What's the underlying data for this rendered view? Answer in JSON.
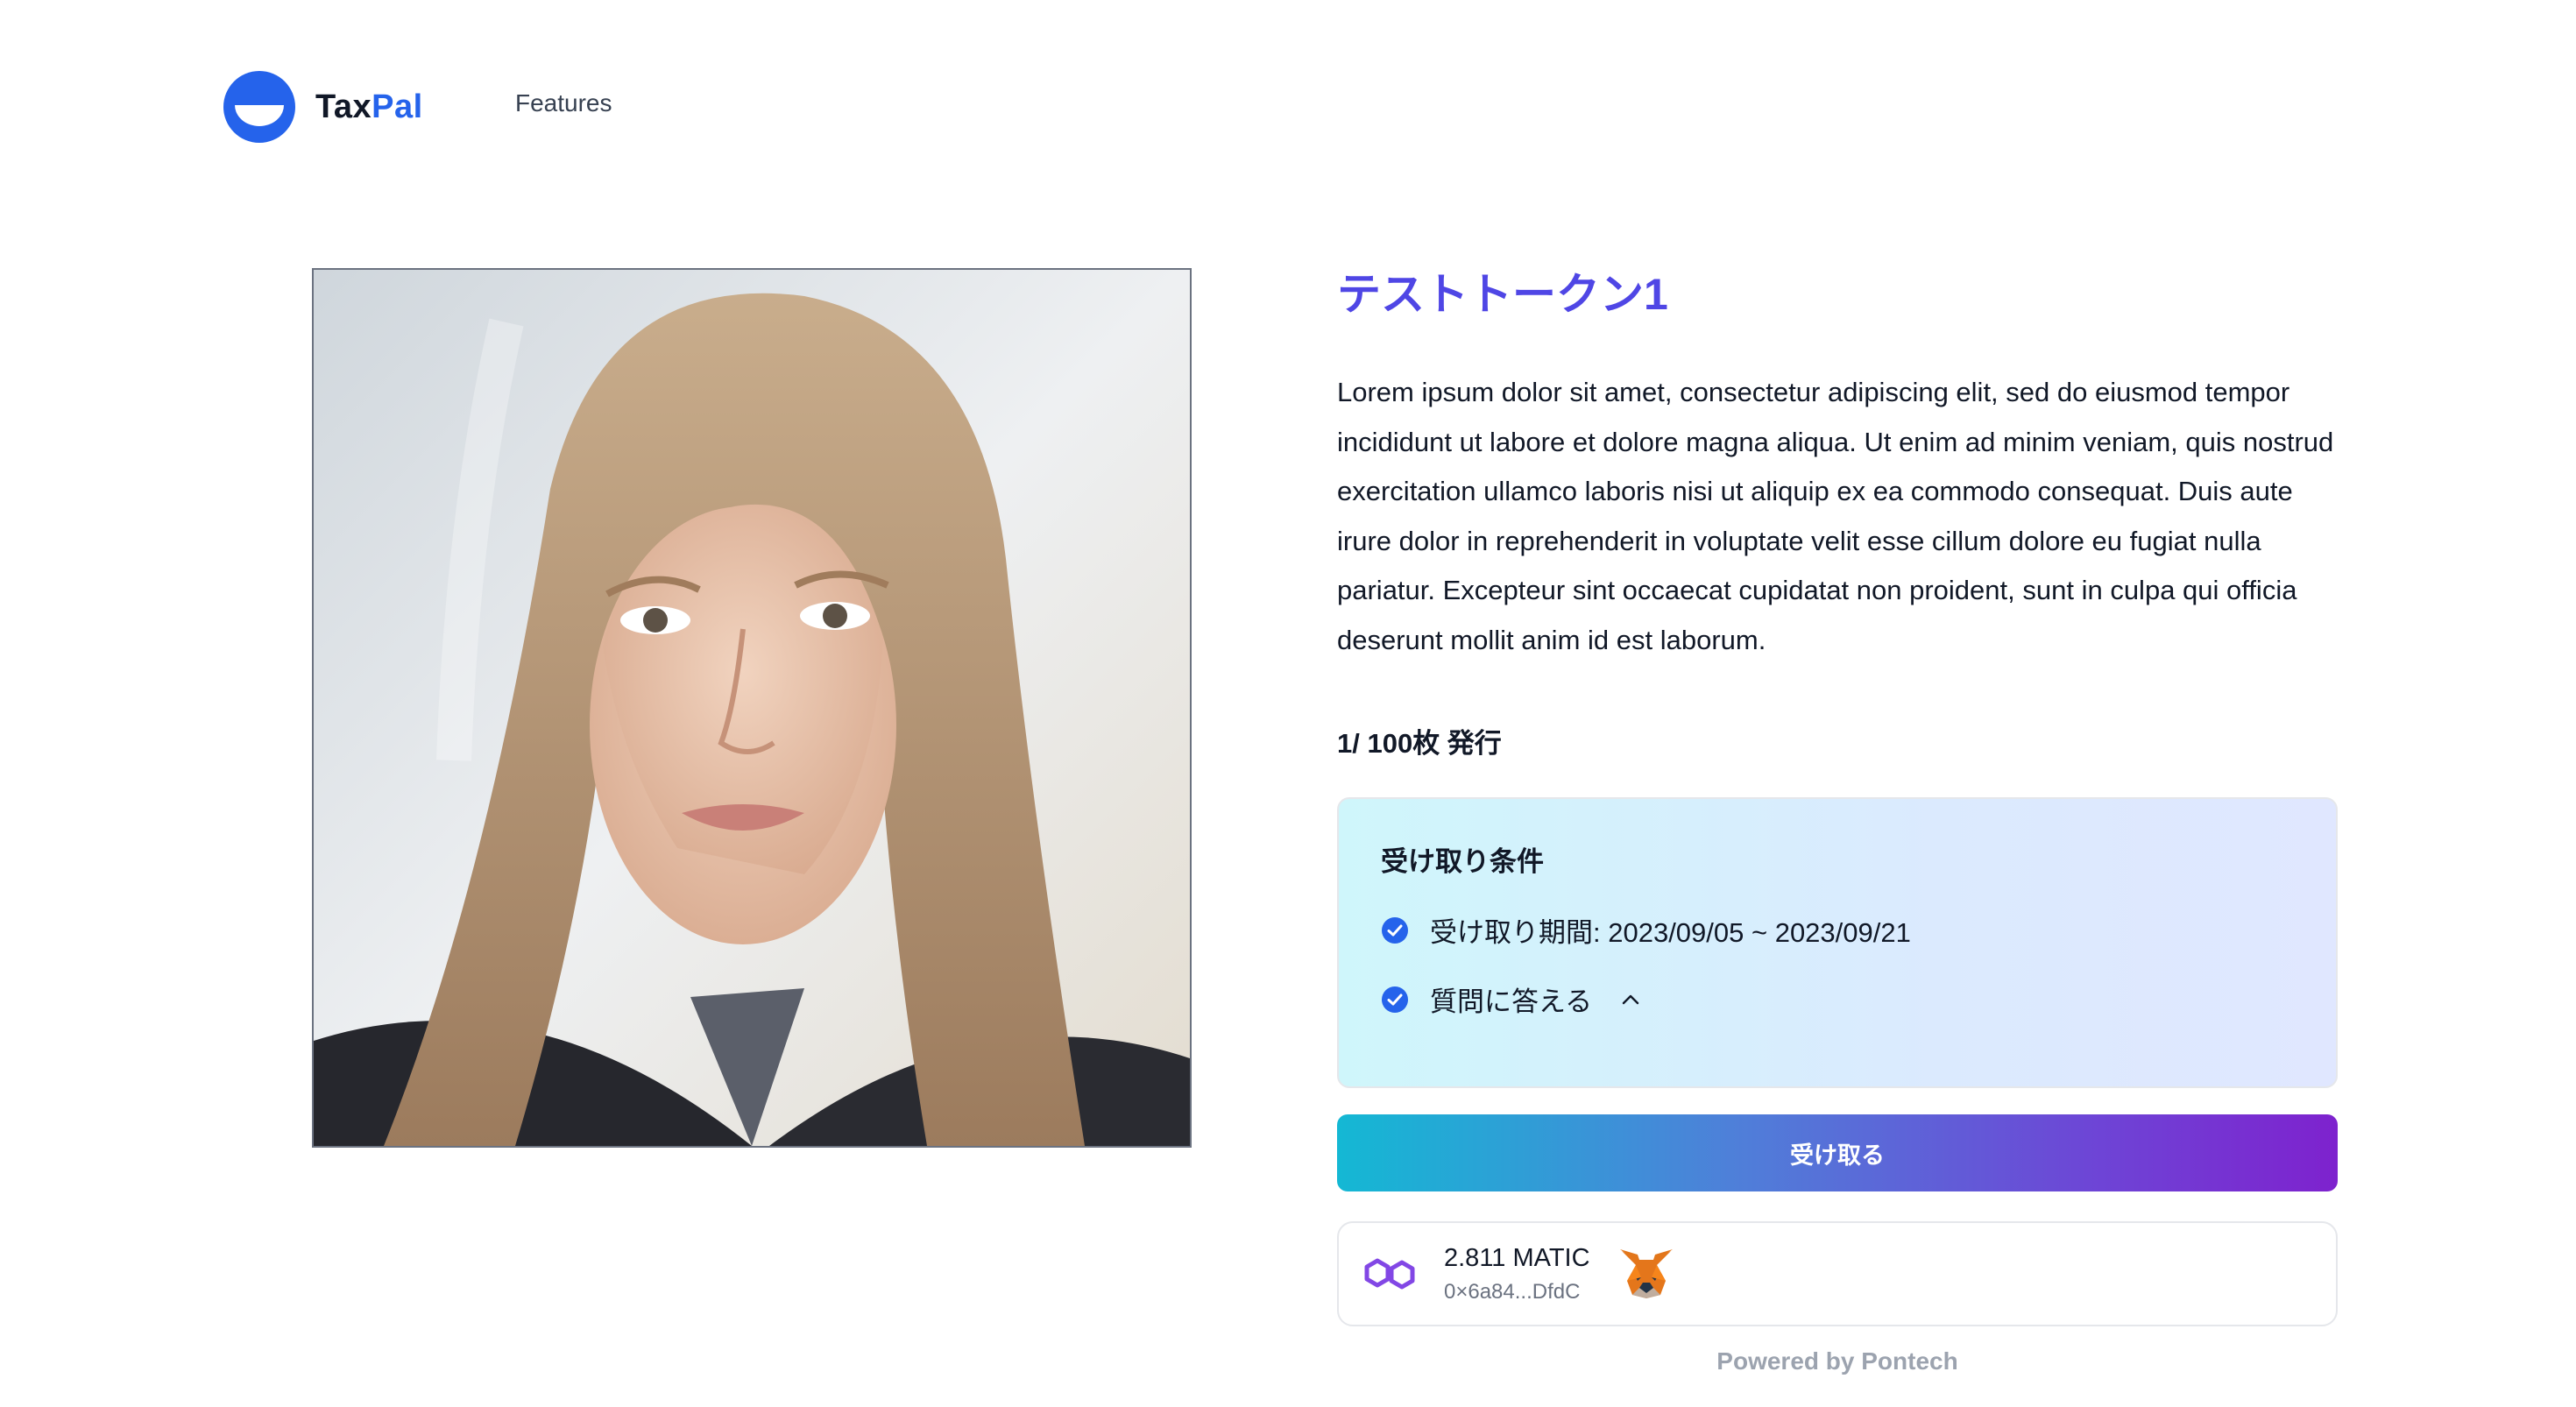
{
  "header": {
    "logo_text_part1": "Tax",
    "logo_text_part2": "Pal",
    "nav_features": "Features",
    "brand_color": "#2563eb"
  },
  "token": {
    "title": "テストトークン1",
    "description": "Lorem ipsum dolor sit amet, consectetur adipiscing elit, sed do eiusmod tempor incididunt ut labore et dolore magna aliqua. Ut enim ad minim veniam, quis nostrud exercitation ullamco laboris nisi ut aliquip ex ea commodo consequat. Duis aute irure dolor in reprehenderit in voluptate velit esse cillum dolore eu fugiat nulla pariatur. Excepteur sint occaecat cupidatat non proident, sunt in culpa qui officia deserunt mollit anim id est laborum.",
    "supply": "1/ 100枚 発行",
    "image_icon": "portrait-photo"
  },
  "conditions": {
    "title": "受け取り条件",
    "items": [
      {
        "label": "受け取り期間: 2023/09/05 ~ 2023/09/21",
        "icon": "check-circle-icon"
      },
      {
        "label": "質問に答える",
        "icon": "check-circle-icon",
        "toggle_icon": "chevron-up-icon"
      }
    ]
  },
  "claim_button": {
    "label": "受け取る"
  },
  "wallet": {
    "balance": "2.811 MATIC",
    "address": "0×6a84...DfdC",
    "network_icon": "polygon-icon",
    "wallet_icon": "metamask-fox-icon"
  },
  "footer": {
    "powered_by": "Powered by Pontech"
  },
  "colors": {
    "title_purple": "#4f46e5",
    "check_blue": "#2563eb",
    "button_gradient_start": "#14b8d4",
    "button_gradient_end": "#7e22ce"
  }
}
